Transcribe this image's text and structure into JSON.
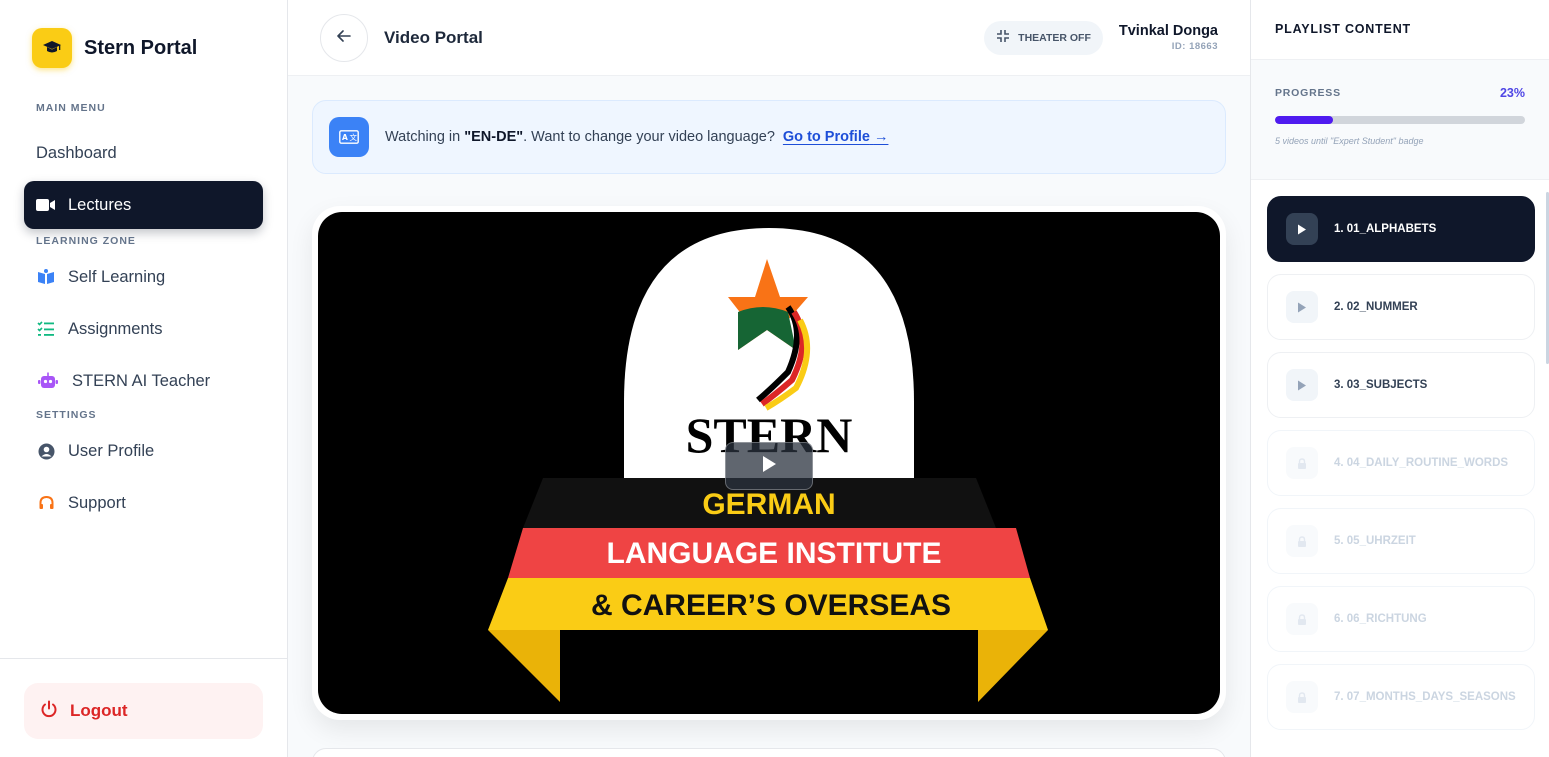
{
  "brand": {
    "name": "Stern Portal"
  },
  "sidebar": {
    "main_menu_label": "MAIN MENU",
    "learning_zone_label": "LEARNING ZONE",
    "settings_label": "SETTINGS",
    "items": [
      {
        "label": "Dashboard",
        "icon": "none"
      },
      {
        "label": "Lectures",
        "icon": "video-camera-icon"
      },
      {
        "label": "Self Learning",
        "icon": "book-icon"
      },
      {
        "label": "Assignments",
        "icon": "checklist-icon"
      },
      {
        "label": "STERN AI Teacher",
        "icon": "robot-icon"
      },
      {
        "label": "User Profile",
        "icon": "user-icon"
      },
      {
        "label": "Support",
        "icon": "headset-icon"
      }
    ],
    "logout_label": "Logout"
  },
  "header": {
    "title": "Video Portal",
    "theater_label": "THEATER OFF",
    "user_name": "Tvinkal Donga",
    "user_id": "ID: 18663"
  },
  "language_banner": {
    "prefix": "Watching in ",
    "language": "\"EN-DE\"",
    "suffix": ". Want to change your video language?",
    "link_label": "Go to Profile"
  },
  "video": {
    "logo_word": "STERN",
    "ribbon_line1": "GERMAN",
    "ribbon_line2": "LANGUAGE INSTITUTE",
    "ribbon_line3": "& CAREER’S OVERSEAS"
  },
  "playlist": {
    "title": "PLAYLIST CONTENT",
    "progress_label": "PROGRESS",
    "progress_text": "23%",
    "progress_value": 0.23,
    "progress_note": "5 videos until \"Expert Student\" badge",
    "items": [
      {
        "label": "1. 01_ALPHABETS",
        "state": "active"
      },
      {
        "label": "2. 02_NUMMER",
        "state": "available"
      },
      {
        "label": "3. 03_SUBJECTS",
        "state": "available"
      },
      {
        "label": "4. 04_DAILY_ROUTINE_WORDS",
        "state": "locked"
      },
      {
        "label": "5. 05_UHRZEIT",
        "state": "locked"
      },
      {
        "label": "6. 06_RICHTUNG",
        "state": "locked"
      },
      {
        "label": "7. 07_MONTHS_DAYS_SEASONS",
        "state": "locked"
      }
    ]
  },
  "colors": {
    "accent": "#4f1bf0",
    "dark": "#0f172a",
    "brand_yellow": "#facc15",
    "logout_red": "#dc2626"
  }
}
